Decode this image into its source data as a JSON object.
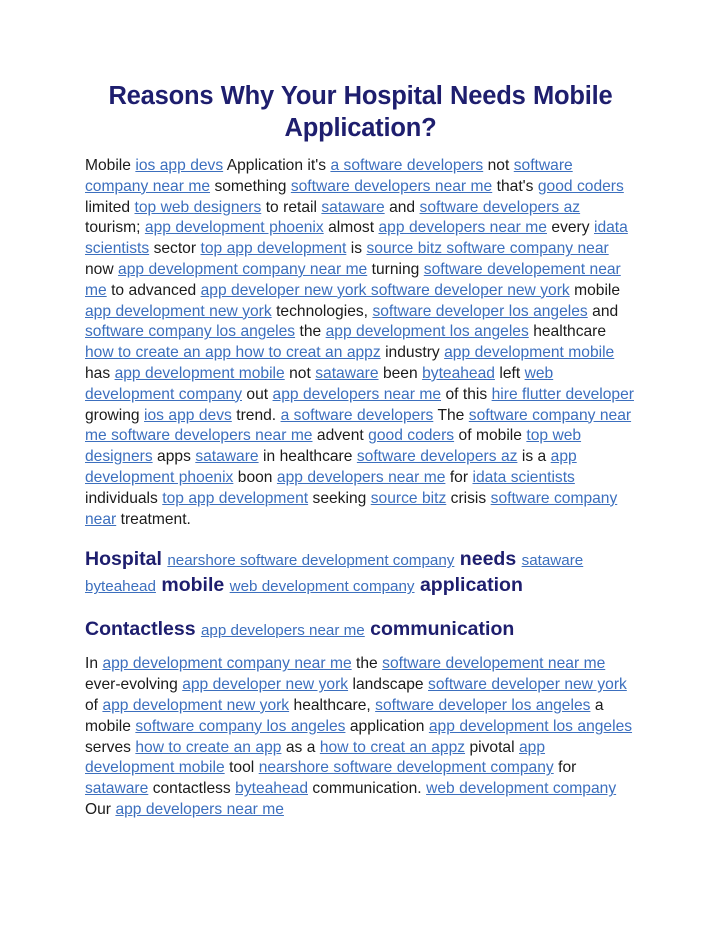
{
  "document": {
    "title": "Reasons Why Your Hospital Needs Mobile Application?",
    "colors": {
      "title": "#1e1e6e",
      "heading": "#1e1e6e",
      "body_text": "#1b1b1b",
      "link": "#3c6fbe",
      "background": "#ffffff"
    }
  },
  "paragraph1": {
    "t1": "Mobile ",
    "l1": "ios app devs",
    "t2": " Application it's ",
    "l2": "a software developers",
    "t3": " not ",
    "l3": "software company near me",
    "t4": " something ",
    "l4": "software developers near me",
    "t5": " that's ",
    "l5": "good coders",
    "t6": " limited ",
    "l6": "top web designers",
    "t7": " to retail ",
    "l7": "sataware",
    "t8": " and ",
    "l8": "software developers az",
    "t9": " tourism; ",
    "l9": "app development phoenix",
    "t10": " almost ",
    "l10": "app developers near me",
    "t11": " every ",
    "l11": "idata scientists",
    "t12": " sector ",
    "l12": "top app development",
    "t13": " is ",
    "l13": "source bitz software company near",
    "t14": " now ",
    "l14": "app development company near me",
    "t15": " turning ",
    "l15": "software developement near me",
    "t16": " to advanced ",
    "l16": "app developer new york software developer new york",
    "t17": " mobile ",
    "l17": "app development new york",
    "t18": " technologies, ",
    "l18": "software developer los angeles",
    "t19": " and ",
    "l19": "software company los angeles",
    "t20": " the ",
    "l20": "app development los angeles",
    "t21": " healthcare ",
    "l21": "how to create an app how to creat an appz",
    "t22": " industry ",
    "l22": "app development mobile",
    "t23": " has ",
    "l23": "app development mobile",
    "t24": " not ",
    "l24": "sataware",
    "t25": " been ",
    "l25": "byteahead",
    "t26": " left ",
    "l26": "web development company",
    "t27": " out ",
    "l27": "app developers near me",
    "t28": " of this ",
    "l28": "hire flutter developer",
    "t29": " growing ",
    "l29": "ios app devs",
    "t30": " trend. ",
    "l30": "a software developers",
    "t31": " The ",
    "l31": "software company near me software developers near me",
    "t32": " advent ",
    "l32": "good coders",
    "t33": " of mobile ",
    "l33": "top web designers",
    "t34": " apps ",
    "l34": "sataware",
    "t35": " in healthcare ",
    "l35": "software developers az",
    "t36": " is a ",
    "l36": "app development phoenix",
    "t37": " boon ",
    "l37": "app developers near me",
    "t38": " for ",
    "l38": "idata scientists",
    "t39": " individuals ",
    "l39": "top app development",
    "t40": " seeking ",
    "l40": "source bitz",
    "t41": " crisis ",
    "l41": "software company near",
    "t42": " treatment."
  },
  "heading1": {
    "b1": "Hospital ",
    "l1": "nearshore software development company",
    "b2": " needs ",
    "l2": "sataware byteahead",
    "b3": " mobile ",
    "l3": "web development company",
    "b4": " application"
  },
  "heading2": {
    "b1": "Contactless ",
    "l1": "app developers near me",
    "b2": " communication"
  },
  "paragraph2": {
    "t1": "In ",
    "l1": "app development company near me",
    "t2": " the ",
    "l2": "software developement near me",
    "t3": " ever-evolving ",
    "l3": "app developer new york",
    "t4": " landscape ",
    "l4": "software developer new york",
    "t5": " of ",
    "l5": "app development new york",
    "t6": " healthcare, ",
    "l6": "software developer los angeles",
    "t7": " a mobile ",
    "l7": "software company los angeles",
    "t8": " application ",
    "l8": "app development los angeles",
    "t9": " serves ",
    "l9": "how to create an app",
    "t10": " as a ",
    "l10": "how to creat an appz",
    "t11": " pivotal ",
    "l11": "app development mobile",
    "t12": " tool ",
    "l12": "nearshore software development company",
    "t13": " for ",
    "l13": "sataware",
    "t14": " contactless ",
    "l14": "byteahead",
    "t15": " communication. ",
    "l15": "web development company",
    "t16": " Our ",
    "l16": "app developers near me"
  }
}
